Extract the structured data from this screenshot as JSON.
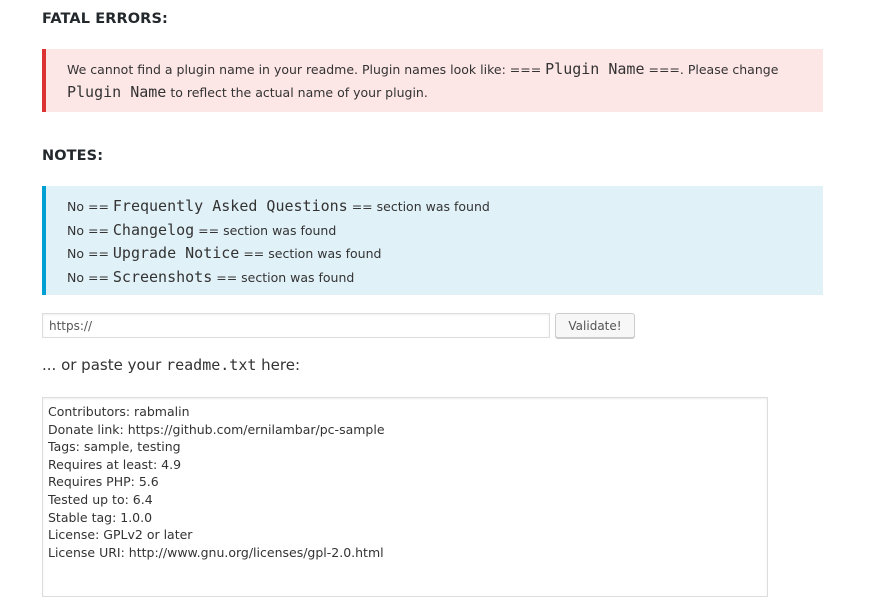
{
  "fatal_errors": {
    "heading": "FATAL ERRORS:",
    "message": {
      "part1": "We cannot find a plugin name in your readme. Plugin names look like: === ",
      "code1": "Plugin Name",
      "part2": " ===. Please change",
      "code2": "Plugin Name",
      "part3": " to reflect the actual name of your plugin."
    }
  },
  "notes": {
    "heading": "NOTES:",
    "items": [
      {
        "prefix": "No == ",
        "section": "Frequently Asked Questions",
        "suffix": " == section was found"
      },
      {
        "prefix": "No == ",
        "section": "Changelog",
        "suffix": " == section was found"
      },
      {
        "prefix": "No == ",
        "section": "Upgrade Notice",
        "suffix": " == section was found"
      },
      {
        "prefix": "No == ",
        "section": "Screenshots",
        "suffix": " == section was found"
      }
    ]
  },
  "url_form": {
    "url_value": "https://",
    "validate_label": "Validate!"
  },
  "paste": {
    "label_prefix": "... or paste your ",
    "label_code": "readme.txt",
    "label_suffix": " here:",
    "readme_content": "Contributors: rabmalin\nDonate link: https://github.com/ernilambar/pc-sample\nTags: sample, testing\nRequires at least: 4.9\nRequires PHP: 5.6\nTested up to: 6.4\nStable tag: 1.0.0\nLicense: GPLv2 or later\nLicense URI: http://www.gnu.org/licenses/gpl-2.0.html\n"
  },
  "colors": {
    "error_accent": "#dc3232",
    "error_background": "#fde6e6",
    "info_accent": "#00a0d2",
    "info_background": "#e1f1f8"
  }
}
